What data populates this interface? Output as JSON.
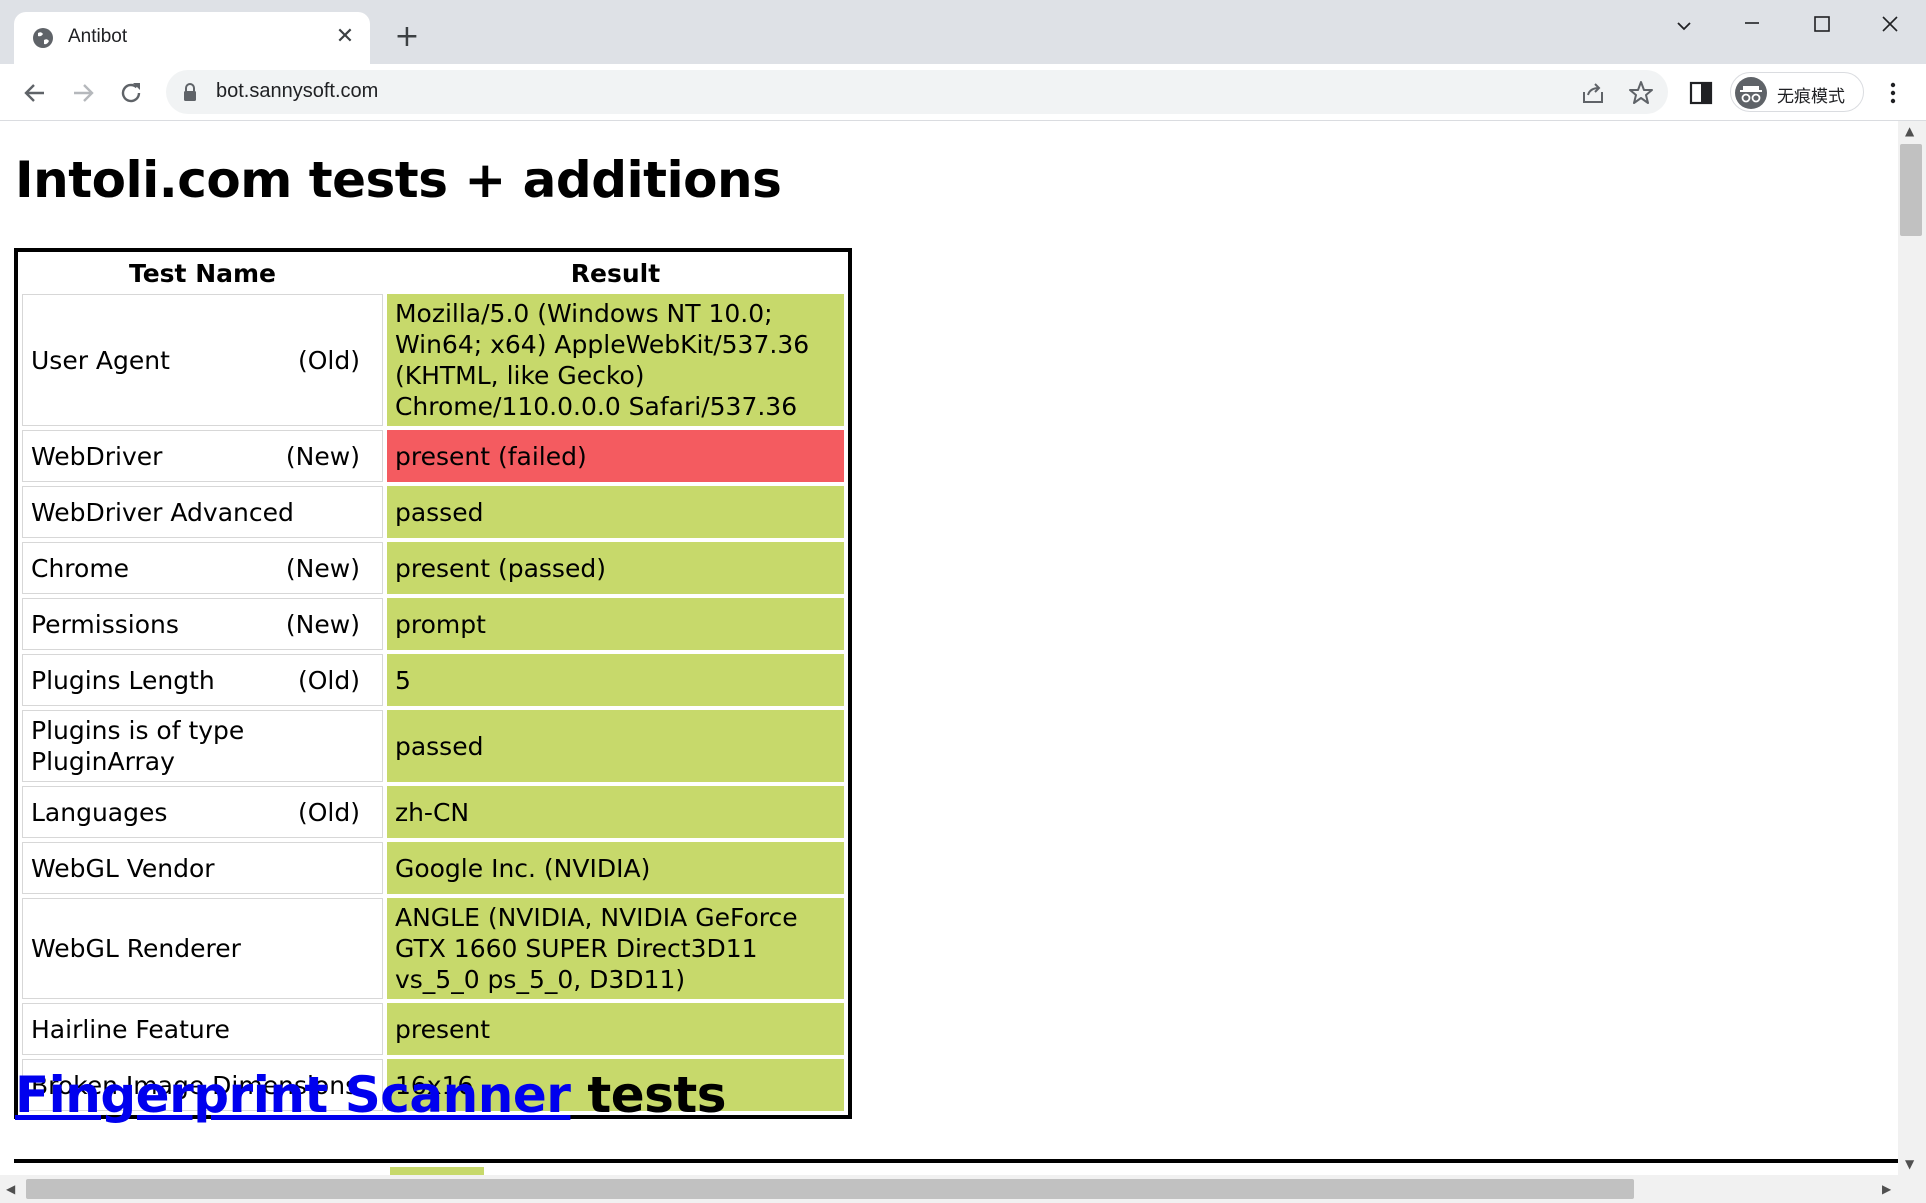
{
  "browser": {
    "tab_title": "Antibot",
    "url": "bot.sannysoft.com",
    "profile_label": "无痕模式"
  },
  "page": {
    "title": "Intoli.com tests + additions",
    "table": {
      "headers": [
        "Test Name",
        "Result"
      ],
      "rows": [
        {
          "name": "User Agent",
          "tag": "(Old)",
          "result": "Mozilla/5.0 (Windows NT 10.0; Win64; x64) AppleWebKit/537.36 (KHTML, like Gecko) Chrome/110.0.0.0 Safari/537.36",
          "status": "passed"
        },
        {
          "name": "WebDriver",
          "tag": "(New)",
          "result": "present (failed)",
          "status": "failed"
        },
        {
          "name": "WebDriver Advanced",
          "tag": "",
          "result": "passed",
          "status": "passed"
        },
        {
          "name": "Chrome",
          "tag": "(New)",
          "result": "present (passed)",
          "status": "passed"
        },
        {
          "name": "Permissions",
          "tag": "(New)",
          "result": "prompt",
          "status": "passed"
        },
        {
          "name": "Plugins Length",
          "tag": "(Old)",
          "result": "5",
          "status": "passed"
        },
        {
          "name": "Plugins is of type PluginArray",
          "tag": "",
          "result": "passed",
          "status": "passed"
        },
        {
          "name": "Languages",
          "tag": "(Old)",
          "result": "zh-CN",
          "status": "passed"
        },
        {
          "name": "WebGL Vendor",
          "tag": "",
          "result": "Google Inc. (NVIDIA)",
          "status": "passed"
        },
        {
          "name": "WebGL Renderer",
          "tag": "",
          "result": "ANGLE (NVIDIA, NVIDIA GeForce GTX 1660 SUPER Direct3D11 vs_5_0 ps_5_0, D3D11)",
          "status": "passed"
        },
        {
          "name": "Hairline Feature",
          "tag": "",
          "result": "present",
          "status": "passed"
        },
        {
          "name": "Broken Image Dimensions",
          "tag": "",
          "result": "16x16",
          "status": "passed"
        }
      ]
    },
    "fingerprint": {
      "link_text": "Fingerprint Scanner",
      "suffix": " tests"
    }
  },
  "colors": {
    "passed": "#c7d96b",
    "failed": "#f45b60",
    "link": "#0000ee"
  }
}
